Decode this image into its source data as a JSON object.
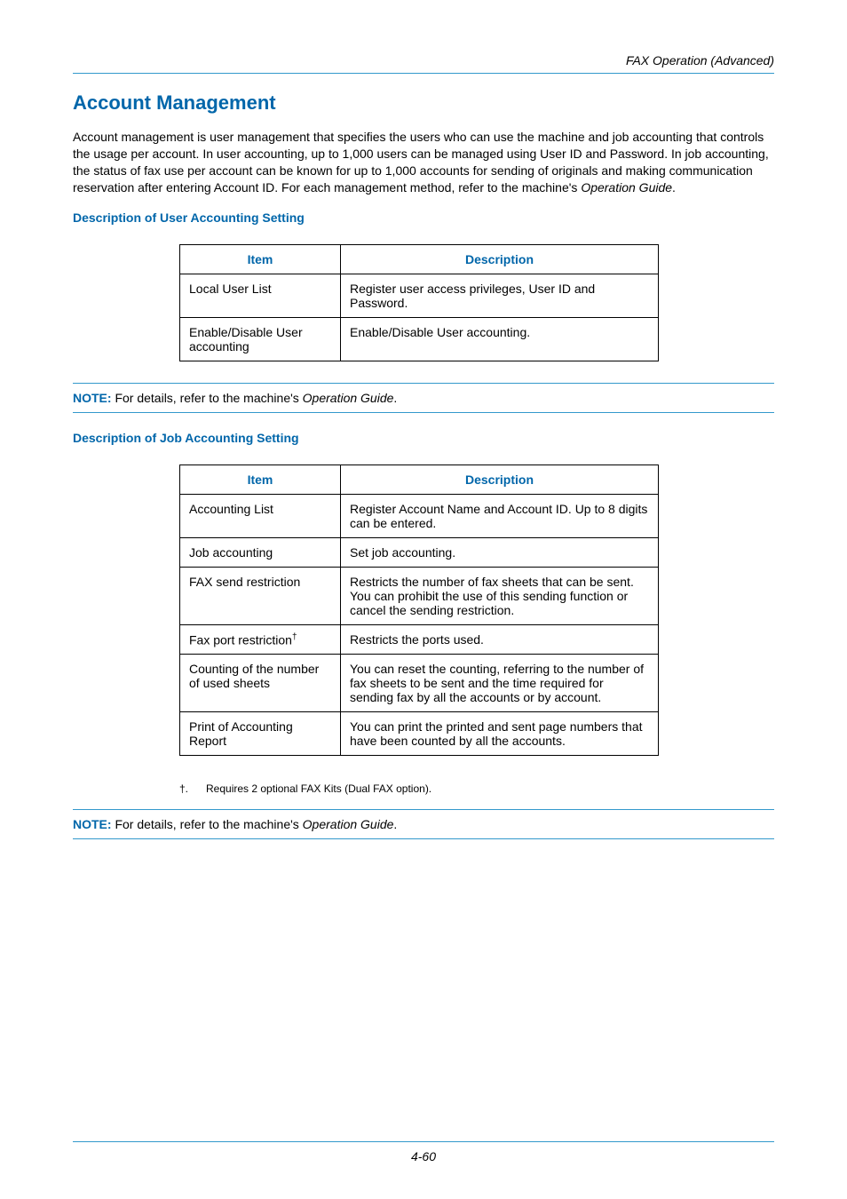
{
  "header": {
    "section_title": "FAX Operation (Advanced)"
  },
  "main": {
    "title": "Account Management",
    "intro_p1": "Account management is user management that specifies the users who can use the machine and job accounting that controls the usage per account. In user accounting, up to 1,000 users can be managed using User ID and Password. In job accounting, the status of fax use per account can be known for up to 1,000 accounts for sending of originals and making communication reservation after entering Account ID. For each management method, refer to the machine's ",
    "intro_em": "Operation Guide",
    "intro_p2": "."
  },
  "user_acct": {
    "heading": "Description of User Accounting Setting",
    "th_item": "Item",
    "th_desc": "Description",
    "rows": [
      {
        "item": "Local User List",
        "desc": "Register user access privileges, User ID and Password."
      },
      {
        "item": "Enable/Disable User accounting",
        "desc": "Enable/Disable User accounting."
      }
    ]
  },
  "note1": {
    "label": "NOTE:",
    "text": " For details, refer to the machine's ",
    "em": "Operation Guide",
    "suffix": "."
  },
  "job_acct": {
    "heading": "Description of Job Accounting Setting",
    "th_item": "Item",
    "th_desc": "Description",
    "rows": [
      {
        "item": "Accounting List",
        "desc": "Register Account Name and Account ID. Up to 8 digits can be entered."
      },
      {
        "item": "Job accounting",
        "desc": "Set job accounting."
      },
      {
        "item": "FAX send restriction",
        "desc": "Restricts the number of fax sheets that can be sent. You can prohibit the use of this sending function or cancel the sending restriction."
      },
      {
        "item": "Fax port restriction",
        "dagger": "†",
        "desc": "Restricts the ports used."
      },
      {
        "item": "Counting of the number of used sheets",
        "desc": "You can reset the counting, referring to the number of fax sheets to be sent and the time required for sending fax by all the accounts or by account."
      },
      {
        "item": "Print of Accounting Report",
        "desc": "You can print the printed and sent page numbers that have been counted by all the accounts."
      }
    ],
    "footnote_mark": "†.",
    "footnote_text": "Requires 2 optional FAX Kits (Dual FAX option)."
  },
  "note2": {
    "label": "NOTE:",
    "text": " For details, refer to the machine's ",
    "em": "Operation Guide",
    "suffix": "."
  },
  "footer": {
    "page": "4-60"
  }
}
